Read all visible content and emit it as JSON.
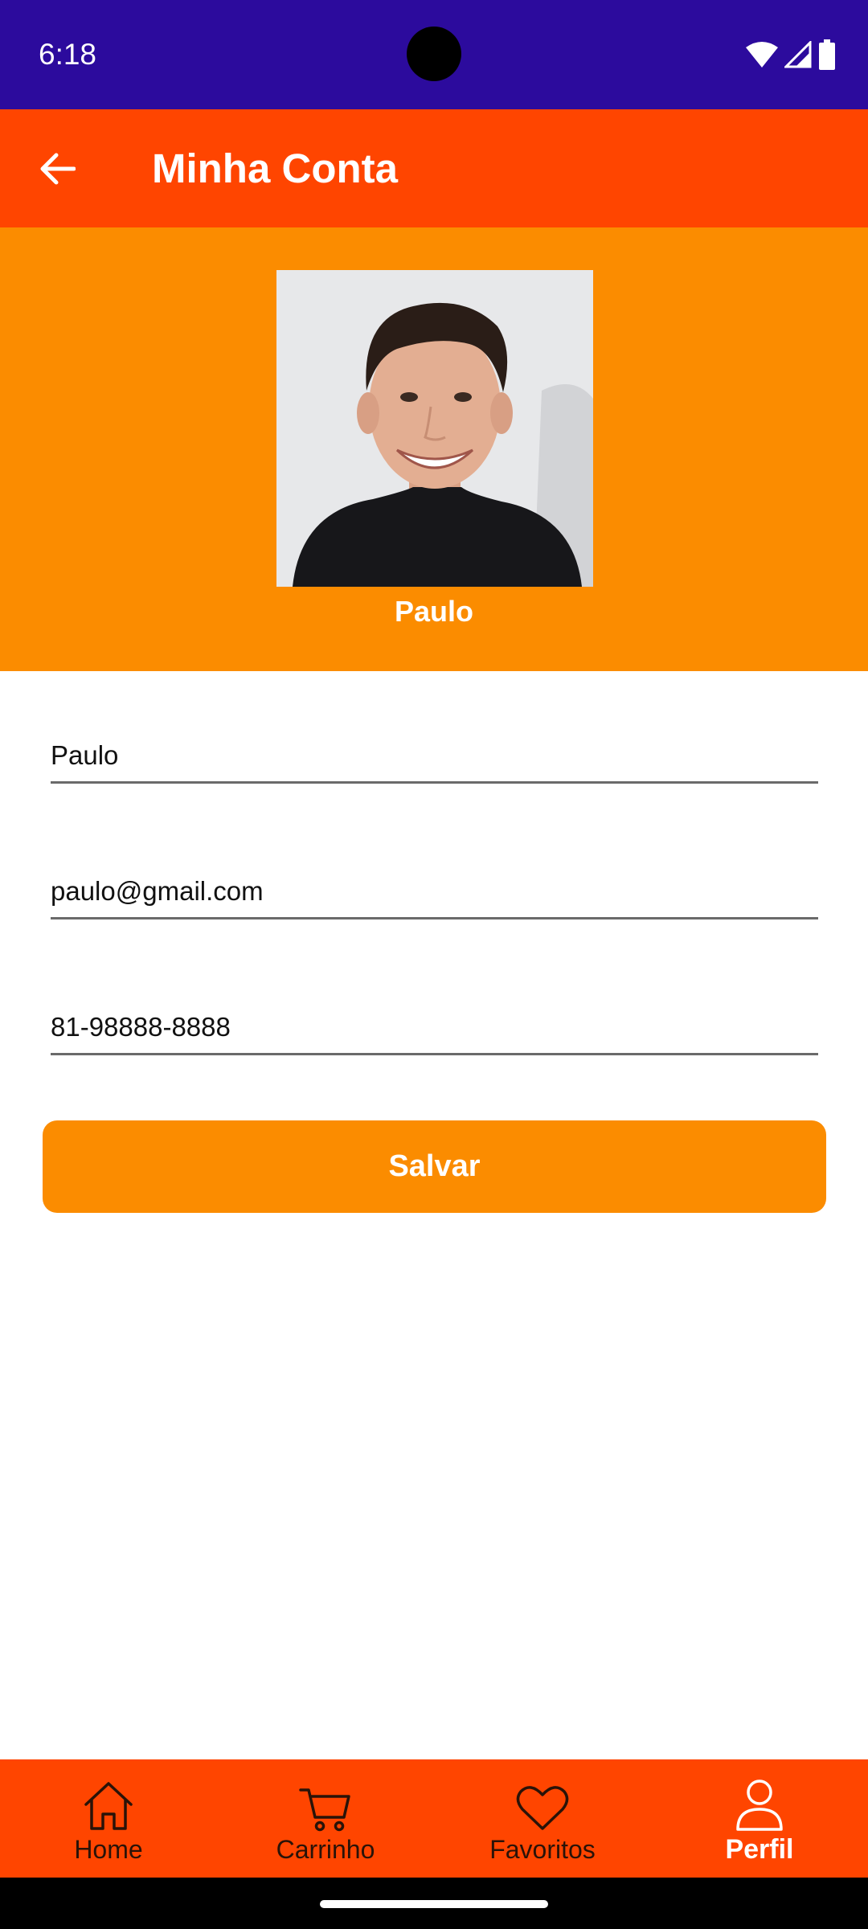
{
  "status_bar": {
    "time": "6:18"
  },
  "app_bar": {
    "title": "Minha Conta",
    "back_icon": "arrow-left-icon"
  },
  "profile": {
    "name": "Paulo"
  },
  "form": {
    "name_value": "Paulo",
    "email_value": "paulo@gmail.com",
    "phone_value": "81-98888-8888",
    "save_label": "Salvar"
  },
  "bottom_nav": {
    "items": [
      {
        "label": "Home",
        "icon": "home-icon",
        "active": false
      },
      {
        "label": "Carrinho",
        "icon": "cart-icon",
        "active": false
      },
      {
        "label": "Favoritos",
        "icon": "heart-icon",
        "active": false
      },
      {
        "label": "Perfil",
        "icon": "person-icon",
        "active": true
      }
    ]
  },
  "colors": {
    "status_bar": "#2C0B9D",
    "app_bar": "#FF4500",
    "accent": "#FB8C00",
    "nav_bar": "#FF4500"
  }
}
